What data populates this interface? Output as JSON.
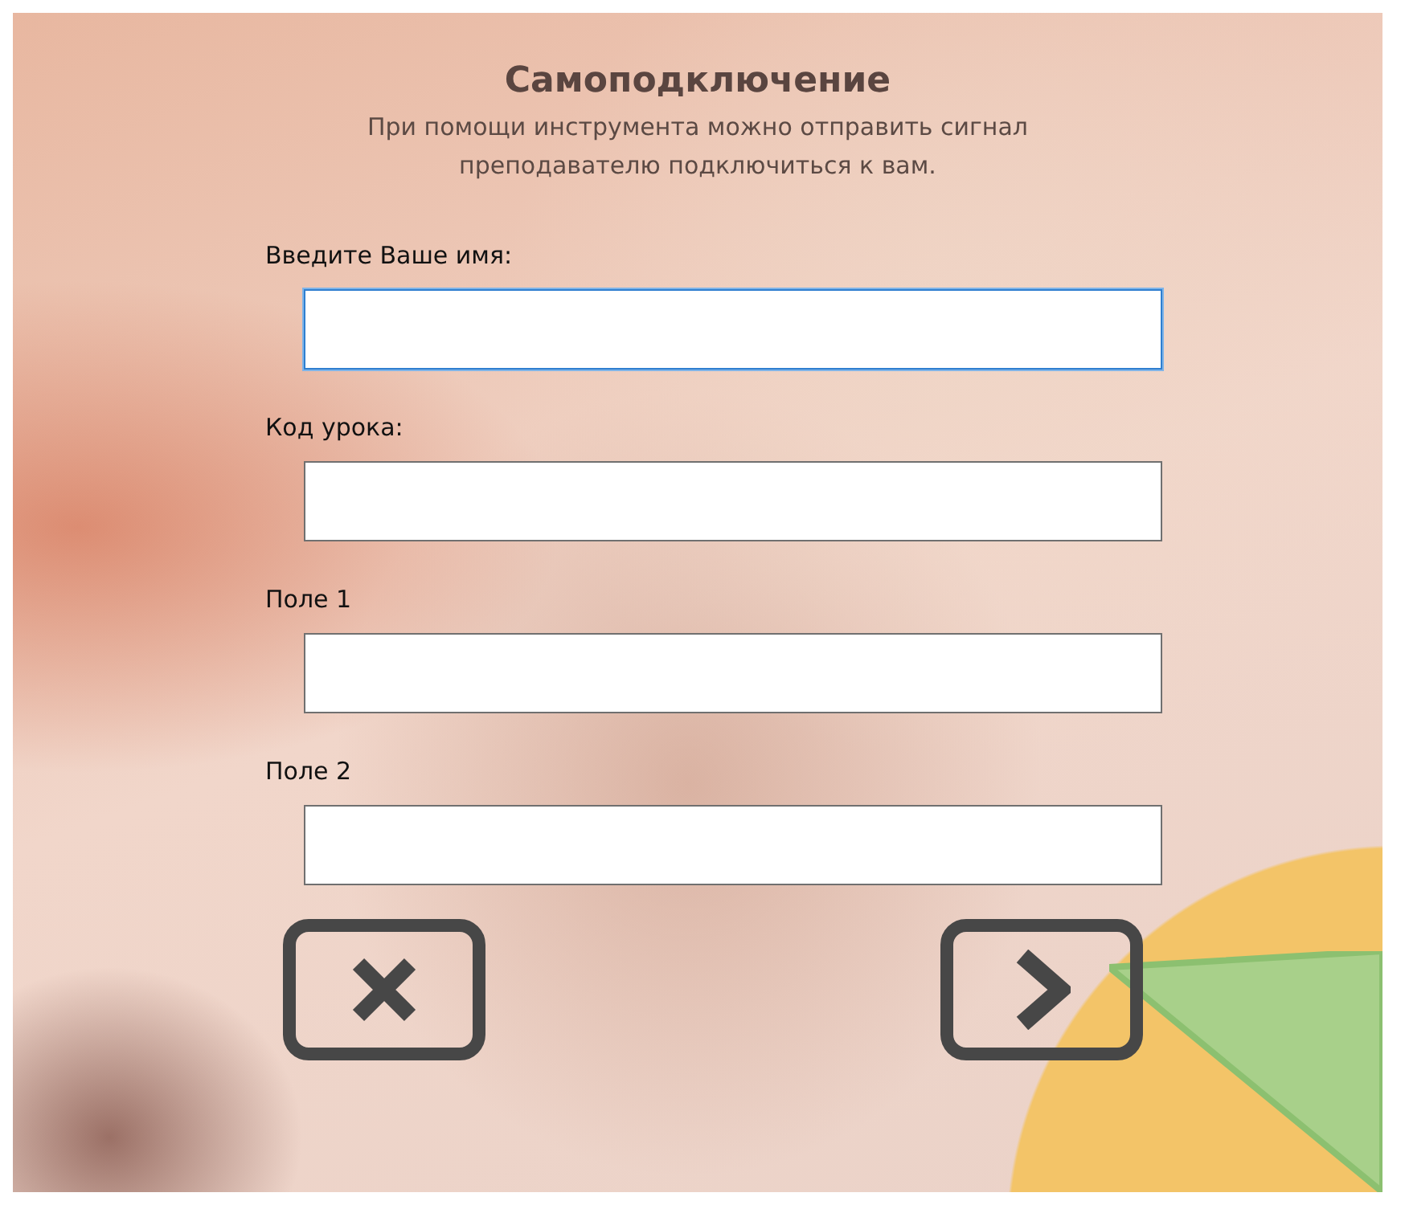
{
  "dialog": {
    "title": "Самоподключение",
    "subtitle": "При помощи инструмента можно отправить сигнал преподавателю подключиться к вам."
  },
  "fields": [
    {
      "label": "Введите Ваше имя:",
      "focused": true
    },
    {
      "label": "Код урока:",
      "focused": false
    },
    {
      "label": "Поле 1",
      "focused": false
    },
    {
      "label": "Поле 2",
      "focused": false
    }
  ],
  "buttons": [
    {
      "kind": "cancel"
    },
    {
      "kind": "next"
    }
  ]
}
